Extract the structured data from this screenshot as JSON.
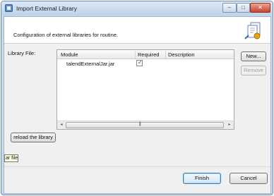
{
  "window": {
    "title": "Import External Library",
    "icons": {
      "app": "import-library-icon",
      "minimize": "minimize-icon",
      "maximize": "maximize-icon",
      "close": "close-icon"
    },
    "controls": {
      "minimize": "–",
      "maximize": "□",
      "close": "✕"
    }
  },
  "header": {
    "message": "Configuration of external libraries for routine.",
    "banner_icon": "external-library-icon"
  },
  "library": {
    "label": "Library File:",
    "columns": [
      "Module",
      "Required",
      "Description"
    ],
    "rows": [
      {
        "module": "talendExternalJar.jar",
        "required": true,
        "description": ""
      }
    ],
    "check_glyph": "✓",
    "scroll_glyphs": {
      "left": "◂",
      "right": "▸",
      "grip": "|||"
    }
  },
  "buttons": {
    "new": "New...",
    "remove": "Remove",
    "reload": "reload the library",
    "finish": "Finish",
    "cancel": "Cancel"
  },
  "tooltip": {
    "text": "ar file"
  },
  "colors": {
    "title_bar": "#c8d9ec",
    "close_button": "#c6452f",
    "default_button_border": "#3c7fb1"
  }
}
